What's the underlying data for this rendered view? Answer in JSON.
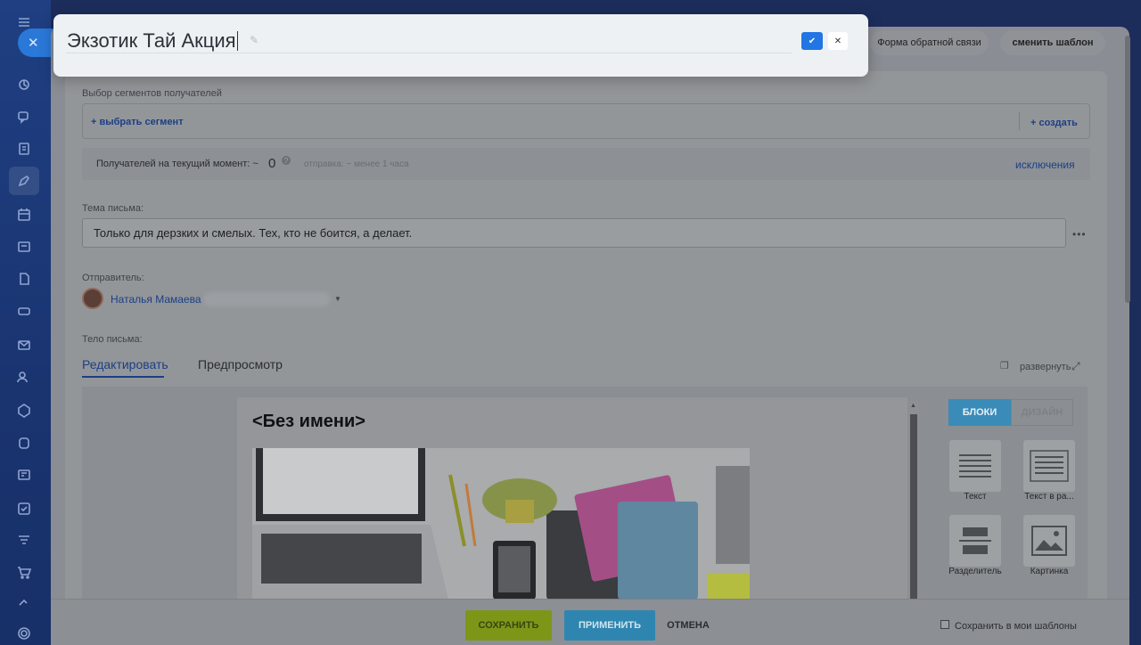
{
  "popup": {
    "title_value": "Экзотик Тай Акция",
    "confirm_icon": "checkmark-icon",
    "cancel_icon": "close-icon"
  },
  "header": {
    "feedback_form_label": "Форма обратной связи",
    "change_template_label": "сменить шаблон"
  },
  "segments": {
    "label": "Выбор сегментов получателей",
    "select_link": "+ выбрать сегмент",
    "create_link": "+ создать"
  },
  "recipients": {
    "label": "Получателей на текущий момент: ~",
    "count": "0",
    "send_time": "отправка: ~ менее 1 часа",
    "exclusions_link": "исключения"
  },
  "subject": {
    "label": "Тема письма:",
    "value": "Только для дерзких и смелых. Тех, кто не боится, а делает."
  },
  "sender": {
    "label": "Отправитель:",
    "name": "Наталья Мамаева"
  },
  "body": {
    "label": "Тело письма:",
    "tab_edit": "Редактировать",
    "tab_preview": "Предпросмотр",
    "expand_label": "развернуть"
  },
  "editor": {
    "letter_title": "<Без имени>",
    "tab_blocks": "БЛОКИ",
    "tab_design": "ДИЗАЙН",
    "blocks": [
      {
        "label": "Текст"
      },
      {
        "label": "Текст в ра..."
      },
      {
        "label": "Разделитель"
      },
      {
        "label": "Картинка"
      }
    ]
  },
  "footer": {
    "save_label": "СОХРАНИТЬ",
    "apply_label": "ПРИМЕНИТЬ",
    "cancel_label": "ОТМЕНА",
    "save_template_label": "Сохранить в мои шаблоны"
  },
  "colors": {
    "accent_blue": "#2176e4",
    "save_green": "#a3c318",
    "apply_cyan": "#3da3d4"
  }
}
